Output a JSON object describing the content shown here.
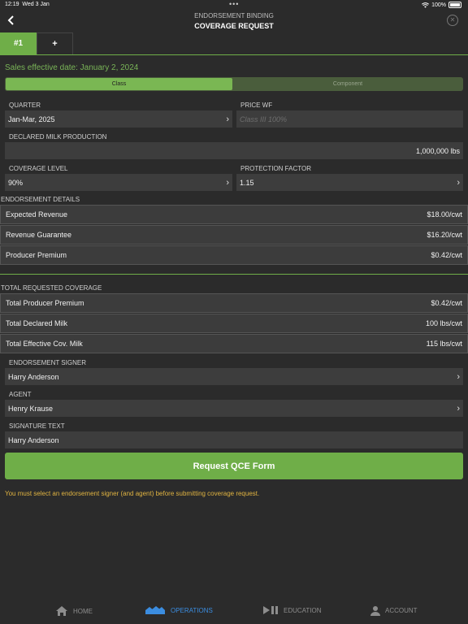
{
  "status": {
    "time": "12:19",
    "date": "Wed 3 Jan",
    "battery": "100%"
  },
  "header": {
    "subtitle": "ENDORSEMENT BINDING",
    "title": "COVERAGE REQUEST"
  },
  "tabs": [
    {
      "label": "#1"
    },
    {
      "label": "+"
    }
  ],
  "sales_effective": "Sales effective date: January 2, 2024",
  "segment": {
    "selected": "Class",
    "other": "Component"
  },
  "quarter": {
    "label": "QUARTER",
    "value": "Jan-Mar, 2025"
  },
  "price_wf": {
    "label": "PRICE WF",
    "placeholder": "Class III 100%"
  },
  "declared_milk": {
    "label": "DECLARED MILK PRODUCTION",
    "value": "1,000,000 lbs"
  },
  "coverage_level": {
    "label": "COVERAGE LEVEL",
    "value": "90%"
  },
  "protection_factor": {
    "label": "PROTECTION FACTOR",
    "value": "1.15"
  },
  "endorsement_details": {
    "title": "ENDORSEMENT DETAILS",
    "rows": [
      {
        "label": "Expected Revenue",
        "value": "$18.00/cwt"
      },
      {
        "label": "Revenue Guarantee",
        "value": "$16.20/cwt"
      },
      {
        "label": "Producer Premium",
        "value": "$0.42/cwt"
      }
    ]
  },
  "total_requested": {
    "title": "TOTAL REQUESTED COVERAGE",
    "rows": [
      {
        "label": "Total Producer Premium",
        "value": "$0.42/cwt"
      },
      {
        "label": "Total Declared Milk",
        "value": "100 lbs/cwt"
      },
      {
        "label": "Total Effective Cov. Milk",
        "value": "115 lbs/cwt"
      }
    ]
  },
  "signer": {
    "label": "ENDORSEMENT SIGNER",
    "value": "Harry Anderson"
  },
  "agent": {
    "label": "AGENT",
    "value": "Henry Krause"
  },
  "signature_text": {
    "label": "SIGNATURE TEXT",
    "value": "Harry Anderson"
  },
  "submit_label": "Request QCE Form",
  "warning": "You must select an endorsement signer (and agent) before submitting coverage request.",
  "nav": [
    {
      "label": "HOME",
      "icon": "home-icon"
    },
    {
      "label": "OPERATIONS",
      "icon": "operations-icon"
    },
    {
      "label": "EDUCATION",
      "icon": "education-icon"
    },
    {
      "label": "ACCOUNT",
      "icon": "account-icon"
    }
  ],
  "colors": {
    "accent": "#6fae48",
    "background": "#2b2b2b",
    "field": "#3d3d3d",
    "warning": "#e0b341",
    "nav_active": "#3b8de0"
  }
}
